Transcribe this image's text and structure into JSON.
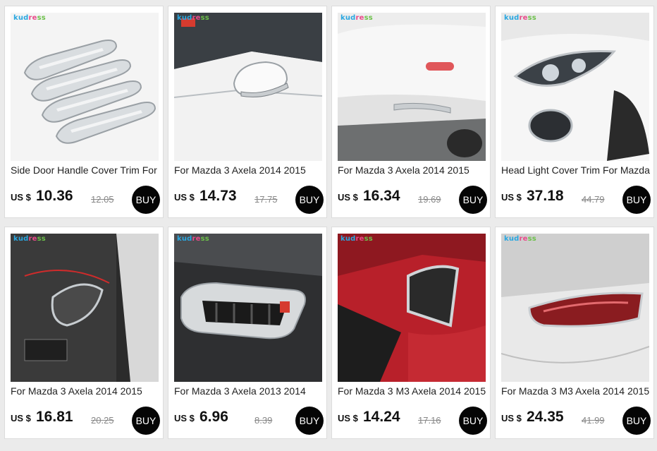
{
  "products": [
    {
      "brand": "kudress",
      "title": "Side Door Handle Cover Trim For",
      "currency": "US $",
      "price": "10.36",
      "old_price": "12.05",
      "buy_label": "BUY"
    },
    {
      "brand": "kudress",
      "title": "For Mazda 3 Axela 2014 2015",
      "currency": "US $",
      "price": "14.73",
      "old_price": "17.75",
      "buy_label": "BUY"
    },
    {
      "brand": "kudress",
      "title": "For Mazda 3 Axela 2014 2015",
      "currency": "US $",
      "price": "16.34",
      "old_price": "19.69",
      "buy_label": "BUY"
    },
    {
      "brand": "kudress",
      "title": "Head Light Cover Trim For Mazda",
      "currency": "US $",
      "price": "37.18",
      "old_price": "44.79",
      "buy_label": "BUY"
    },
    {
      "brand": "kudress",
      "title": "For Mazda 3 Axela 2014 2015",
      "currency": "US $",
      "price": "16.81",
      "old_price": "20.25",
      "buy_label": "BUY"
    },
    {
      "brand": "kudress",
      "title": "For Mazda 3 Axela 2013 2014",
      "currency": "US $",
      "price": "6.96",
      "old_price": "8.39",
      "buy_label": "BUY"
    },
    {
      "brand": "kudress",
      "title": "For Mazda 3 M3 Axela 2014 2015",
      "currency": "US $",
      "price": "14.24",
      "old_price": "17.16",
      "buy_label": "BUY"
    },
    {
      "brand": "kudress",
      "title": "For Mazda 3 M3 Axela 2014 2015",
      "currency": "US $",
      "price": "24.35",
      "old_price": "41.99",
      "buy_label": "BUY"
    }
  ]
}
